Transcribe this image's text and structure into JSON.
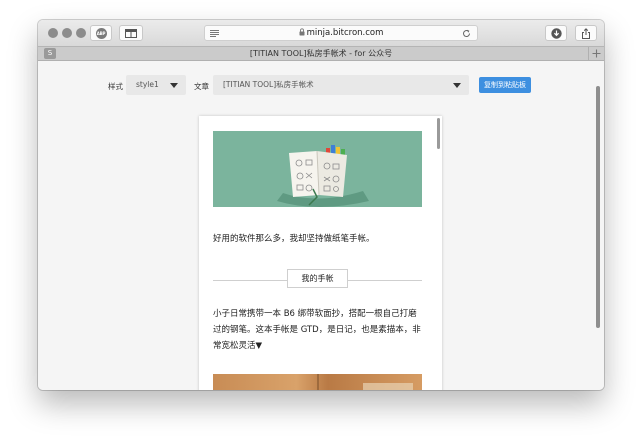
{
  "browser": {
    "address": "minja.bitcron.com",
    "adblock_badge": "ABP",
    "tab_title": "[TITIAN TOOL]私房手帐术 - for 公众号",
    "tab_favicon": "S"
  },
  "controls": {
    "style_label": "样式",
    "style_value": "style1",
    "article_label": "文章",
    "article_value": "[TITIAN TOOL]私房手帐术",
    "copy_button": "复制到粘贴板"
  },
  "article": {
    "intro": "好用的软件那么多，我却坚持做纸笔手帐。",
    "section_title": "我的手帐",
    "paragraph": "小子日常携带一本 B6 绑带软面抄，搭配一根自己打磨过的钢笔。这本手帐是 GTD，是日记，也是素描本，非常宽松灵活▼"
  },
  "colors": {
    "accent": "#3d8fe0",
    "hero_background": "#7bb49d",
    "content_background": "#f5f5f5"
  }
}
